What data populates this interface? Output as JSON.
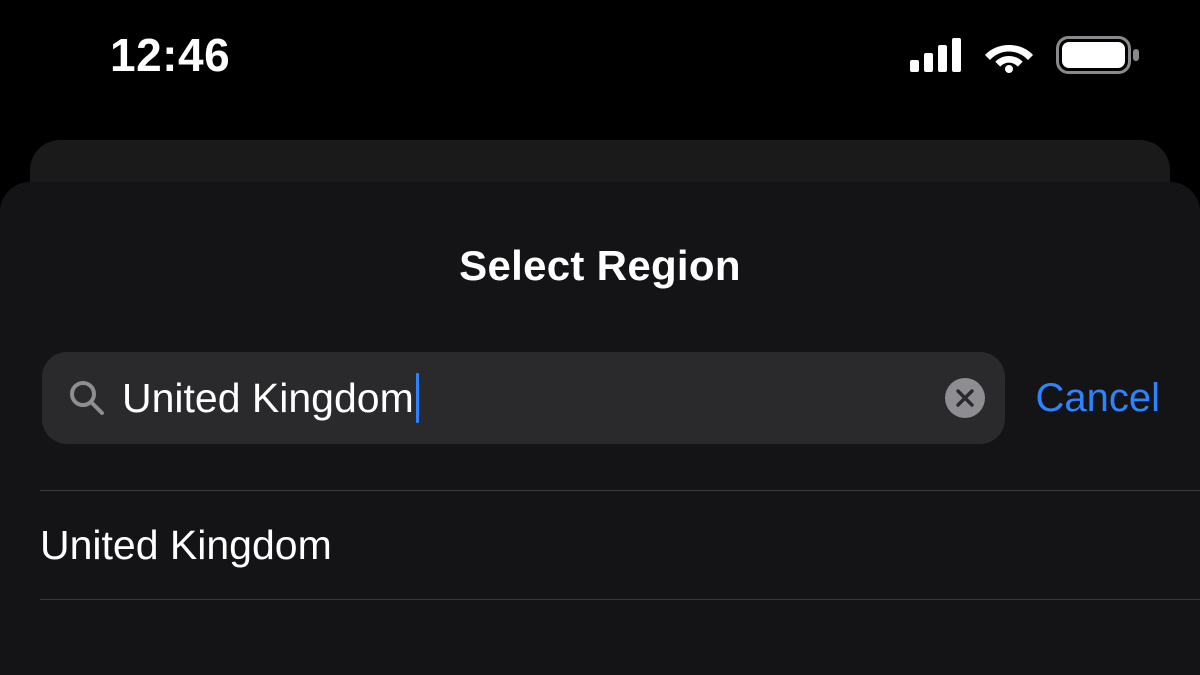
{
  "status_bar": {
    "time": "12:46"
  },
  "sheet": {
    "title": "Select Region",
    "search": {
      "value": "United Kingdom",
      "cancel_label": "Cancel"
    },
    "results": [
      {
        "label": "United Kingdom"
      }
    ]
  }
}
